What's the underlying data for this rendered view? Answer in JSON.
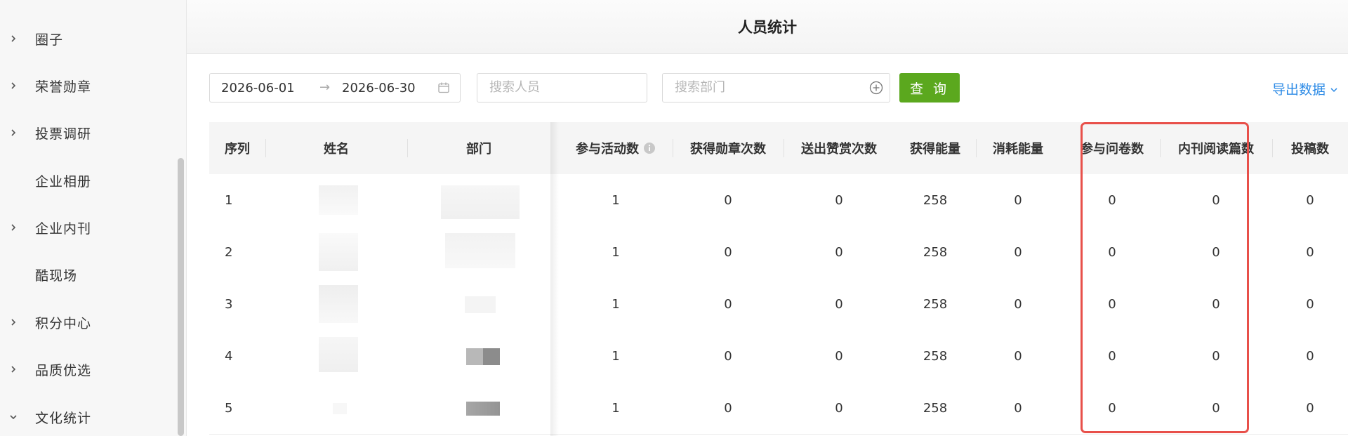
{
  "sidebar": {
    "items": [
      {
        "label": "圈子",
        "icon": "chevron-right-icon",
        "has_chevron": true
      },
      {
        "label": "荣誉勋章",
        "icon": "chevron-right-icon",
        "has_chevron": true
      },
      {
        "label": "投票调研",
        "icon": "chevron-right-icon",
        "has_chevron": true
      },
      {
        "label": "企业相册",
        "has_chevron": false
      },
      {
        "label": "企业内刊",
        "icon": "chevron-right-icon",
        "has_chevron": true
      },
      {
        "label": "酷现场",
        "has_chevron": false
      },
      {
        "label": "积分中心",
        "icon": "chevron-right-icon",
        "has_chevron": true
      },
      {
        "label": "品质优选",
        "icon": "chevron-right-icon",
        "has_chevron": true
      },
      {
        "label": "文化统计",
        "icon": "chevron-down-icon",
        "has_chevron": true,
        "expanded": true
      }
    ]
  },
  "header": {
    "title": "人员统计"
  },
  "filters": {
    "date_start": "2026-06-01",
    "date_arrow": "→",
    "date_end": "2026-06-30",
    "search_person_placeholder": "搜索人员",
    "search_dept_placeholder": "搜索部门",
    "query_label": "查 询",
    "export_label": "导出数据"
  },
  "table": {
    "columns": [
      "序列",
      "姓名",
      "部门",
      "参与活动数",
      "获得勋章次数",
      "送出赞赏次数",
      "获得能量",
      "消耗能量",
      "参与问卷数",
      "内刊阅读篇数",
      "投稿数"
    ],
    "rows": [
      {
        "index": "1",
        "name": "",
        "dept": "",
        "activities": "1",
        "medals": "0",
        "praises": "0",
        "energy_gained": "258",
        "energy_used": "0",
        "surveys": "0",
        "reads": "0",
        "submissions": "0"
      },
      {
        "index": "2",
        "name": "",
        "dept": "",
        "activities": "1",
        "medals": "0",
        "praises": "0",
        "energy_gained": "258",
        "energy_used": "0",
        "surveys": "0",
        "reads": "0",
        "submissions": "0"
      },
      {
        "index": "3",
        "name": "",
        "dept": "",
        "activities": "1",
        "medals": "0",
        "praises": "0",
        "energy_gained": "258",
        "energy_used": "0",
        "surveys": "0",
        "reads": "0",
        "submissions": "0"
      },
      {
        "index": "4",
        "name": "",
        "dept": "",
        "activities": "1",
        "medals": "0",
        "praises": "0",
        "energy_gained": "258",
        "energy_used": "0",
        "surveys": "0",
        "reads": "0",
        "submissions": "0"
      },
      {
        "index": "5",
        "name": "",
        "dept": "",
        "activities": "1",
        "medals": "0",
        "praises": "0",
        "energy_gained": "258",
        "energy_used": "0",
        "surveys": "0",
        "reads": "0",
        "submissions": "0"
      }
    ]
  },
  "colors": {
    "accent_green": "#5ba81e",
    "link_blue": "#2b8ae6",
    "highlight_red": "#e8504a"
  }
}
